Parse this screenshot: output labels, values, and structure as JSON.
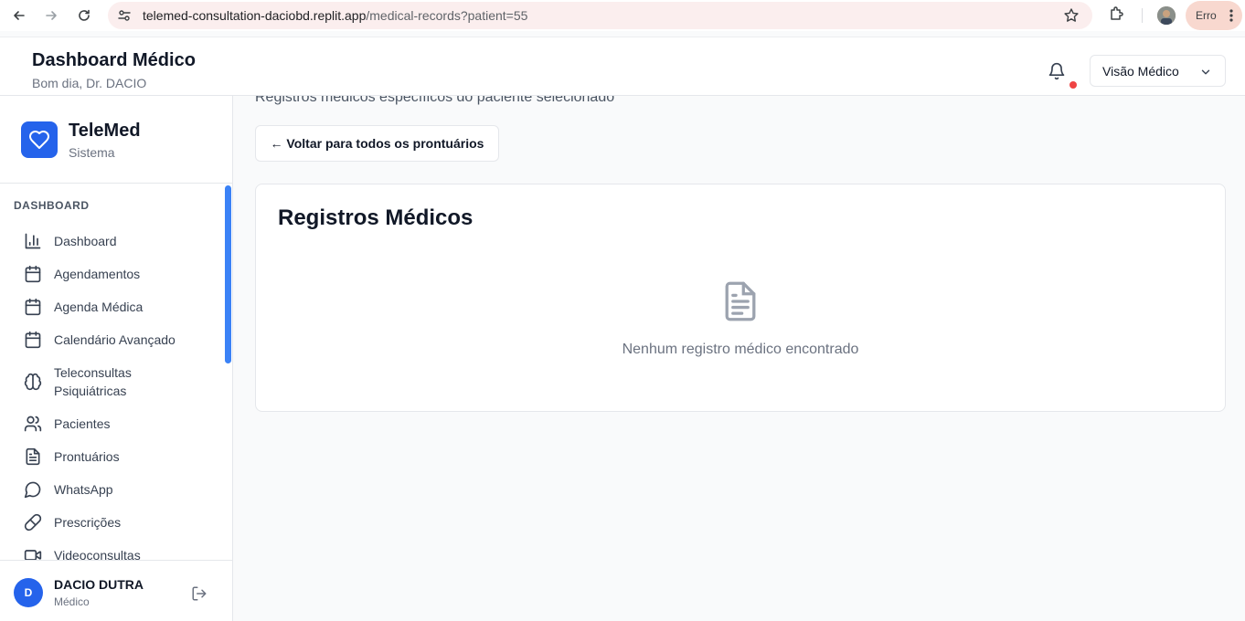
{
  "browser": {
    "url_host": "telemed-consultation-daciobd.replit.app",
    "url_path": "/medical-records?patient=55",
    "profile_status": "Erro"
  },
  "header": {
    "title": "Dashboard Médico",
    "greeting": "Bom dia, Dr. DACIO",
    "view_select": "Visão Médico"
  },
  "brand": {
    "name": "TeleMed",
    "subtitle": "Sistema"
  },
  "sidebar": {
    "section": "DASHBOARD",
    "items": [
      {
        "label": "Dashboard",
        "icon": "bar-chart-icon"
      },
      {
        "label": "Agendamentos",
        "icon": "calendar-icon"
      },
      {
        "label": "Agenda Médica",
        "icon": "calendar-icon"
      },
      {
        "label": "Calendário Avançado",
        "icon": "calendar-icon"
      },
      {
        "label": "Teleconsultas Psiquiátricas",
        "icon": "brain-icon"
      },
      {
        "label": "Pacientes",
        "icon": "users-icon"
      },
      {
        "label": "Prontuários",
        "icon": "file-text-icon"
      },
      {
        "label": "WhatsApp",
        "icon": "message-circle-icon"
      },
      {
        "label": "Prescrições",
        "icon": "pill-icon"
      },
      {
        "label": "Videoconsultas",
        "icon": "video-icon"
      }
    ]
  },
  "user": {
    "initial": "D",
    "name": "DACIO DUTRA",
    "role": "Médico"
  },
  "main": {
    "description": "Registros médicos específicos do paciente selecionado",
    "back_button": "← Voltar para todos os prontuários",
    "card_title": "Registros Médicos",
    "empty_message": "Nenhum registro médico encontrado"
  },
  "colors": {
    "primary": "#2563eb",
    "notification": "#ef4444",
    "scrollbar": "#3b82f6"
  }
}
